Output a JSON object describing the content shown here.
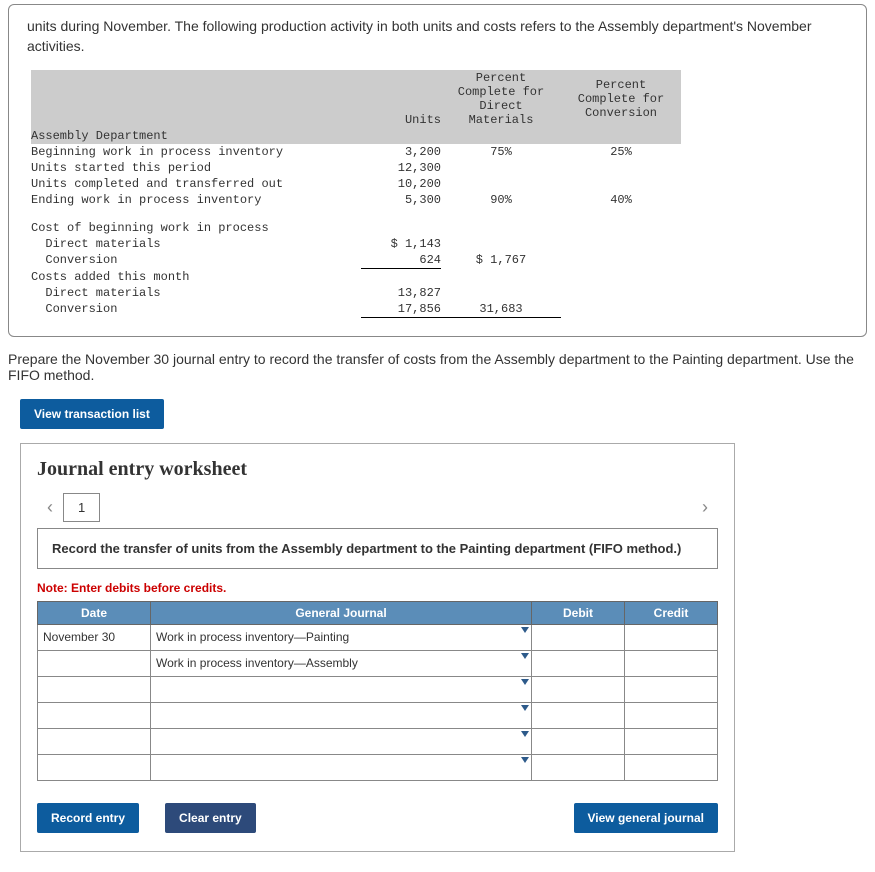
{
  "intro": "units during November. The following production activity in both units and costs refers to the Assembly department's November activities.",
  "table": {
    "headers": {
      "units": "Units",
      "pctDM": "Percent\nComplete for\nDirect\nMaterials",
      "pctConv": "Percent\nComplete for\nConversion"
    },
    "section1": {
      "title": "Assembly Department",
      "rows": [
        {
          "l": "Beginning work in process inventory",
          "u": "3,200",
          "dm": "75%",
          "cv": "25%"
        },
        {
          "l": "Units started this period",
          "u": "12,300",
          "dm": "",
          "cv": ""
        },
        {
          "l": "Units completed and transferred out",
          "u": "10,200",
          "dm": "",
          "cv": ""
        },
        {
          "l": "Ending work in process inventory",
          "u": "5,300",
          "dm": "90%",
          "cv": "40%"
        }
      ]
    },
    "section2": {
      "title": "Cost of beginning work in process",
      "rows": [
        {
          "l": "  Direct materials",
          "a": "$ 1,143",
          "b": ""
        },
        {
          "l": "  Conversion",
          "a": "624",
          "b": "$ 1,767"
        }
      ]
    },
    "section3": {
      "title": "Costs added this month",
      "rows": [
        {
          "l": "  Direct materials",
          "a": "13,827",
          "b": ""
        },
        {
          "l": "  Conversion",
          "a": "17,856",
          "b": "31,683"
        }
      ]
    }
  },
  "instruction": "Prepare the November 30 journal entry to record the transfer of costs from the Assembly department to the Painting department. Use the FIFO method.",
  "buttons": {
    "viewList": "View transaction list",
    "record": "Record entry",
    "clear": "Clear entry",
    "viewGJ": "View general journal"
  },
  "worksheet": {
    "title": "Journal entry worksheet",
    "tab": "1",
    "desc": "Record the transfer of units from the Assembly department to the Painting department (FIFO method.)",
    "note": "Note: Enter debits before credits.",
    "cols": {
      "date": "Date",
      "gj": "General Journal",
      "debit": "Debit",
      "credit": "Credit"
    },
    "rows": [
      {
        "date": "November 30",
        "gj": "Work in process inventory—Painting",
        "d": "",
        "c": ""
      },
      {
        "date": "",
        "gj": "Work in process inventory—Assembly",
        "d": "",
        "c": ""
      },
      {
        "date": "",
        "gj": "",
        "d": "",
        "c": ""
      },
      {
        "date": "",
        "gj": "",
        "d": "",
        "c": ""
      },
      {
        "date": "",
        "gj": "",
        "d": "",
        "c": ""
      },
      {
        "date": "",
        "gj": "",
        "d": "",
        "c": ""
      }
    ]
  }
}
